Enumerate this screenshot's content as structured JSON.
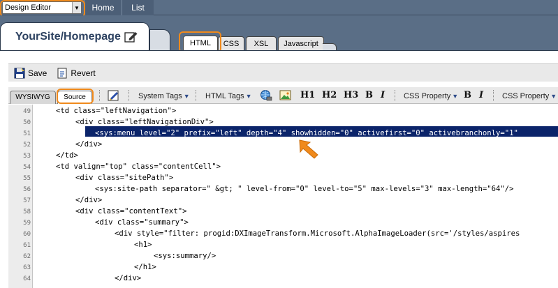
{
  "topbar": {
    "mode_select": {
      "value": "Design Editor"
    },
    "nav": [
      {
        "label": "Home"
      },
      {
        "label": "List"
      }
    ]
  },
  "page": {
    "title": "YourSite/Homepage"
  },
  "code_tabs": [
    {
      "label": "HTML",
      "active": true
    },
    {
      "label": "CSS",
      "active": false
    },
    {
      "label": "XSL",
      "active": false
    },
    {
      "label": "Javascript",
      "active": false
    }
  ],
  "actions": {
    "save_label": "Save",
    "revert_label": "Revert"
  },
  "view_tabs": [
    {
      "label": "WYSIWYG",
      "active": false
    },
    {
      "label": "Source",
      "active": true
    }
  ],
  "toolbar": {
    "system_tags": "System Tags",
    "html_tags": "HTML Tags",
    "h1": "H1",
    "h2": "H2",
    "h3": "H3",
    "bold": "B",
    "italic": "I",
    "css_property_1": "CSS Property",
    "css_property_2": "CSS Property"
  },
  "icons": {
    "dropdown": "dropdown-arrow-icon",
    "edit": "edit-pencil-icon",
    "save": "save-disk-icon",
    "revert": "revert-document-icon",
    "format": "format-pen-icon",
    "link": "globe-link-icon",
    "image": "image-icon",
    "pointer": "orange-arrow-icon"
  },
  "colors": {
    "highlight": "#f08a1c",
    "selection": "#0b246a",
    "topbar": "#5a6e86"
  },
  "editor": {
    "selected_line": 51,
    "lines": [
      {
        "num": "49",
        "text": "<td class=\"leftNavigation\">"
      },
      {
        "num": "50",
        "text": "<div class=\"leftNavigationDiv\">"
      },
      {
        "num": "51",
        "text": "<sys:menu level=\"2\" prefix=\"left\" depth=\"4\" showhidden=\"0\" activefirst=\"0\" activebranchonly=\"1\""
      },
      {
        "num": "52",
        "text": "</div>"
      },
      {
        "num": "53",
        "text": "</td>"
      },
      {
        "num": "54",
        "text": "<td valign=\"top\" class=\"contentCell\">"
      },
      {
        "num": "55",
        "text": "<div class=\"sitePath\">"
      },
      {
        "num": "56",
        "text": "<sys:site-path separator=\" &gt; \" level-from=\"0\" level-to=\"5\" max-levels=\"3\" max-length=\"64\"/>"
      },
      {
        "num": "57",
        "text": "</div>"
      },
      {
        "num": "58",
        "text": "<div class=\"contentText\">"
      },
      {
        "num": "59",
        "text": "<div class=\"summary\">"
      },
      {
        "num": "60",
        "text": "<div style=\"filter: progid:DXImageTransform.Microsoft.AlphaImageLoader(src='/styles/aspires"
      },
      {
        "num": "61",
        "text": "<h1>"
      },
      {
        "num": "62",
        "text": "<sys:summary/>"
      },
      {
        "num": "63",
        "text": "</h1>"
      },
      {
        "num": "64",
        "text": "</div>"
      }
    ]
  }
}
